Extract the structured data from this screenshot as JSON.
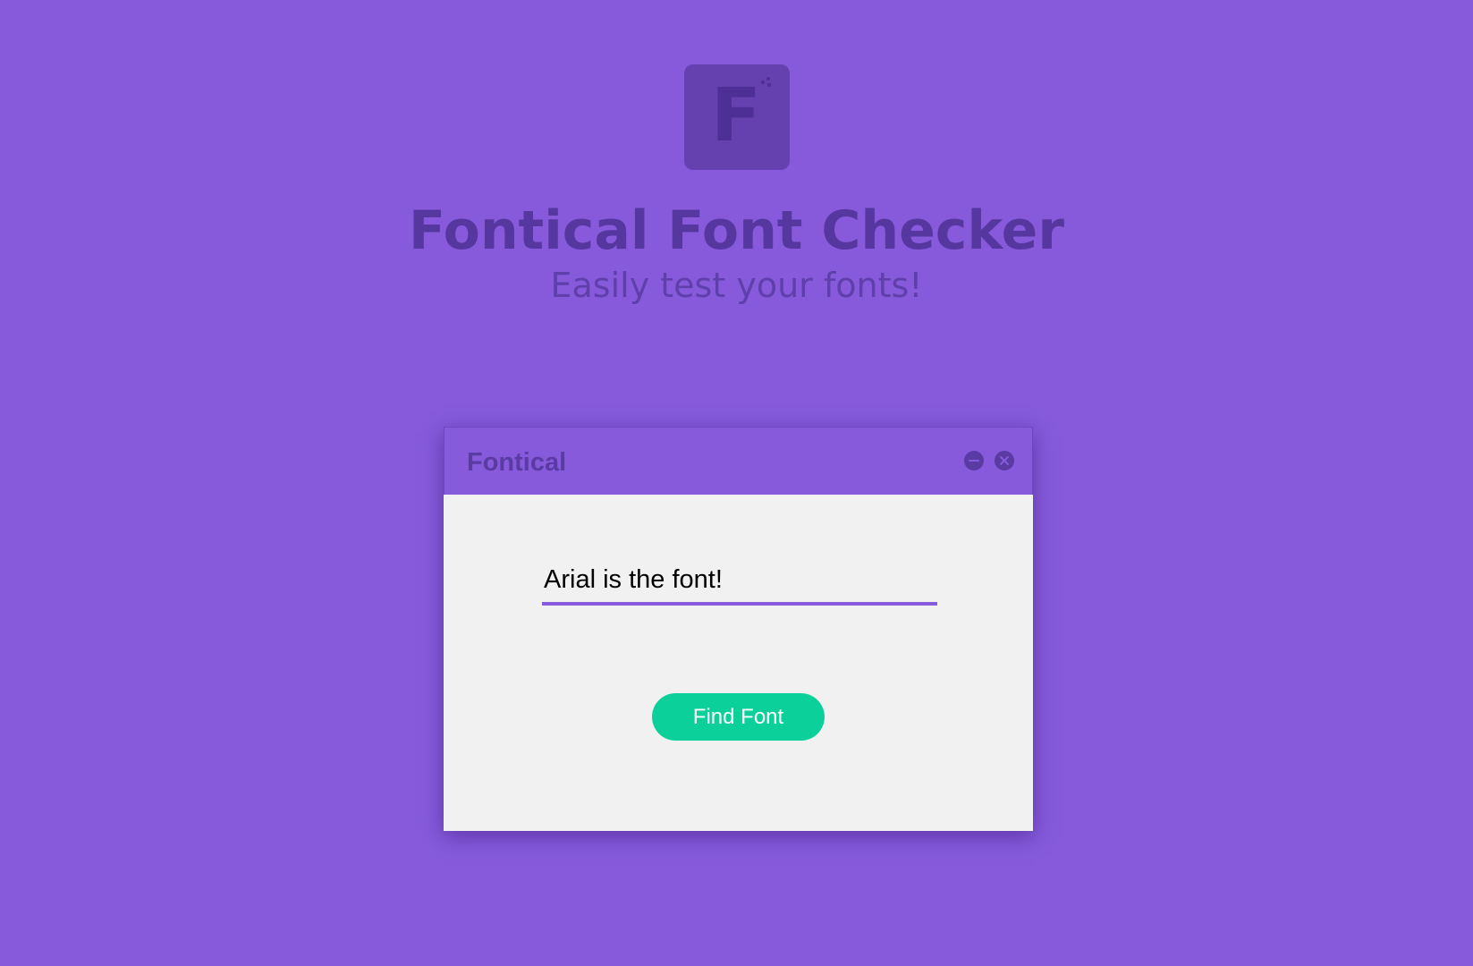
{
  "colors": {
    "background": "#865ADB",
    "logo_tile": "#6441AF",
    "heading": "#56369F",
    "window_body": "#F1F1F1",
    "accent": "#865ADB",
    "button": "#0BD09A"
  },
  "logo": {
    "letter": "F",
    "icon": "sparkle-icon"
  },
  "header": {
    "title": "Fontical Font Checker",
    "subtitle": "Easily test your fonts!"
  },
  "window": {
    "title": "Fontical",
    "minimize_icon": "minimize-icon",
    "close_icon": "close-icon",
    "input": {
      "value": "Arial is the font!"
    },
    "button_label": "Find Font"
  }
}
